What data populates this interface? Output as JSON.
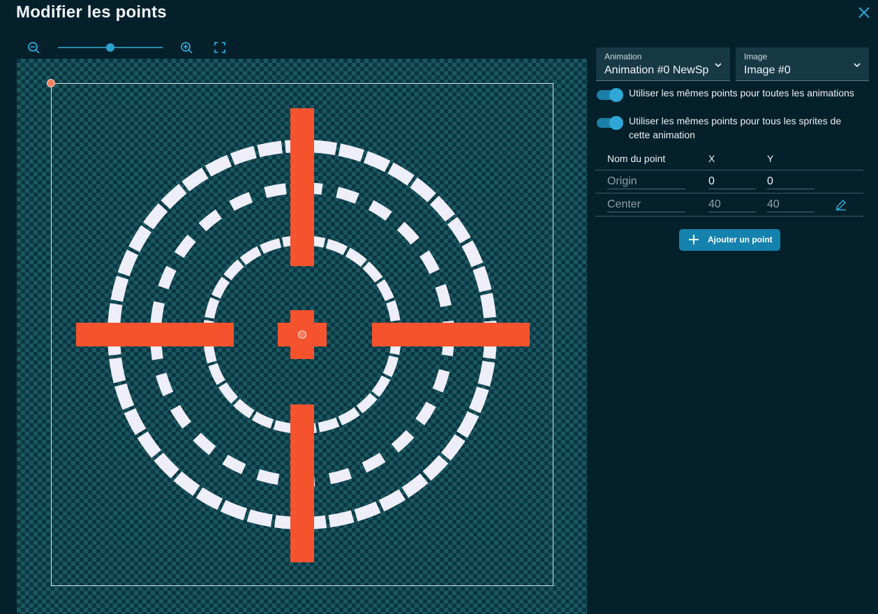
{
  "title": "Modifier les points",
  "toolbar": {
    "zoom_out_icon": "zoom-out-icon",
    "zoom_in_icon": "zoom-in-icon",
    "fit_icon": "fullscreen-icon",
    "zoom_level": 0.5
  },
  "selectors": {
    "animation": {
      "label": "Animation",
      "value": "Animation #0 NewSp"
    },
    "image": {
      "label": "Image",
      "value": "Image #0"
    }
  },
  "toggles": [
    {
      "label": "Utiliser les mêmes points pour toutes les animations",
      "checked": true
    },
    {
      "label": "Utiliser les mêmes points pour tous les sprites de cette animation",
      "checked": true
    }
  ],
  "table": {
    "headers": {
      "name": "Nom du point",
      "x": "X",
      "y": "Y"
    },
    "rows": [
      {
        "name": "Origin",
        "x": "0",
        "y": "0"
      },
      {
        "name": "Center",
        "x": "40",
        "y": "40"
      }
    ]
  },
  "add_button": "Ajouter un point",
  "colors": {
    "background": "#03202b",
    "accent": "#1482ad",
    "sprite_red": "#f4532e",
    "sprite_white": "#eeeef8"
  }
}
